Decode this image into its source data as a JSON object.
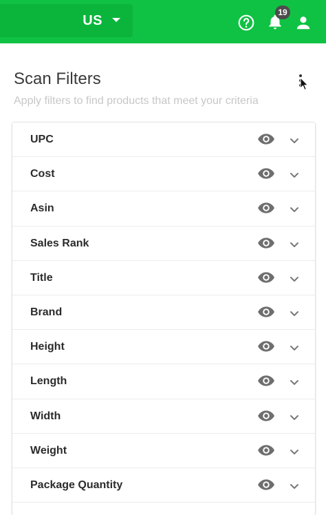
{
  "header": {
    "region_label": "US",
    "notification_count": "19",
    "icons": {
      "help": "help-circle-icon",
      "notifications": "bell-icon",
      "account": "user-icon",
      "region_caret": "caret-down-icon"
    },
    "colors": {
      "bar": "#0fc243",
      "region": "#0bb53c",
      "badge": "#4d4d4d"
    }
  },
  "page": {
    "title": "Scan Filters",
    "subtitle": "Apply filters to find products that meet your criteria",
    "menu_icon": "more-vertical-icon"
  },
  "filters": [
    {
      "label": "UPC"
    },
    {
      "label": "Cost"
    },
    {
      "label": "Asin"
    },
    {
      "label": "Sales Rank"
    },
    {
      "label": "Title"
    },
    {
      "label": "Brand"
    },
    {
      "label": "Height"
    },
    {
      "label": "Length"
    },
    {
      "label": "Width"
    },
    {
      "label": "Weight"
    },
    {
      "label": "Package Quantity"
    }
  ],
  "row_icons": {
    "visibility": "eye-icon",
    "expand": "chevron-down-icon"
  }
}
